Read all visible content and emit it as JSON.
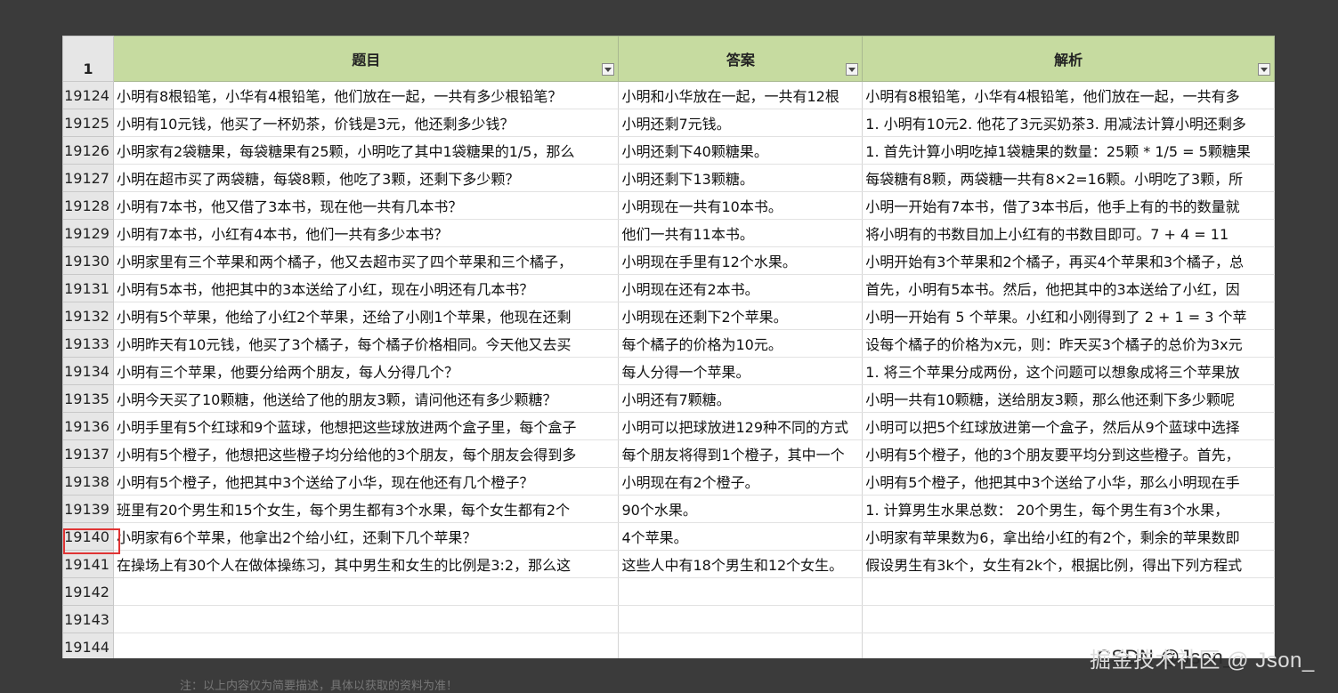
{
  "sheet": {
    "corner_label": "1",
    "columns": [
      "题目",
      "答案",
      "解析"
    ],
    "rows": [
      {
        "num": "19124",
        "q": "小明有8根铅笔，小华有4根铅笔，他们放在一起，一共有多少根铅笔？",
        "a": "小明和小华放在一起，一共有12根",
        "e": "小明有8根铅笔，小华有4根铅笔，他们放在一起，一共有多"
      },
      {
        "num": "19125",
        "q": "小明有10元钱，他买了一杯奶茶，价钱是3元，他还剩多少钱？",
        "a": "小明还剩7元钱。",
        "e": "1. 小明有10元2. 他花了3元买奶茶3. 用减法计算小明还剩多"
      },
      {
        "num": "19126",
        "q": "小明家有2袋糖果，每袋糖果有25颗，小明吃了其中1袋糖果的1/5，那么",
        "a": "小明还剩下40颗糖果。",
        "e": "1. 首先计算小明吃掉1袋糖果的数量：25颗 * 1/5 = 5颗糖果"
      },
      {
        "num": "19127",
        "q": "小明在超市买了两袋糖，每袋8颗，他吃了3颗，还剩下多少颗？",
        "a": "小明还剩下13颗糖。",
        "e": "每袋糖有8颗，两袋糖一共有8×2=16颗。小明吃了3颗，所"
      },
      {
        "num": "19128",
        "q": "小明有7本书，他又借了3本书，现在他一共有几本书？",
        "a": "小明现在一共有10本书。",
        "e": "小明一开始有7本书，借了3本书后，他手上有的书的数量就"
      },
      {
        "num": "19129",
        "q": "小明有7本书，小红有4本书，他们一共有多少本书？",
        "a": "他们一共有11本书。",
        "e": "将小明有的书数目加上小红有的书数目即可。7 + 4 = 11"
      },
      {
        "num": "19130",
        "q": "小明家里有三个苹果和两个橘子，他又去超市买了四个苹果和三个橘子，",
        "a": "小明现在手里有12个水果。",
        "e": "小明开始有3个苹果和2个橘子，再买4个苹果和3个橘子，总"
      },
      {
        "num": "19131",
        "q": "小明有5本书，他把其中的3本送给了小红，现在小明还有几本书？",
        "a": "小明现在还有2本书。",
        "e": "首先，小明有5本书。然后，他把其中的3本送给了小红，因"
      },
      {
        "num": "19132",
        "q": "小明有5个苹果，他给了小红2个苹果，还给了小刚1个苹果，他现在还剩",
        "a": "小明现在还剩下2个苹果。",
        "e": "小明一开始有 5 个苹果。小红和小刚得到了 2 + 1 = 3 个苹"
      },
      {
        "num": "19133",
        "q": "小明昨天有10元钱，他买了3个橘子，每个橘子价格相同。今天他又去买",
        "a": "每个橘子的价格为10元。",
        "e": "设每个橘子的价格为x元，则：昨天买3个橘子的总价为3x元"
      },
      {
        "num": "19134",
        "q": "小明有三个苹果，他要分给两个朋友，每人分得几个？",
        "a": "每人分得一个苹果。",
        "e": "1. 将三个苹果分成两份，这个问题可以想象成将三个苹果放"
      },
      {
        "num": "19135",
        "q": "小明今天买了10颗糖，他送给了他的朋友3颗，请问他还有多少颗糖？",
        "a": "小明还有7颗糖。",
        "e": "小明一共有10颗糖，送给朋友3颗，那么他还剩下多少颗呢"
      },
      {
        "num": "19136",
        "q": "小明手里有5个红球和9个蓝球，他想把这些球放进两个盒子里，每个盒子",
        "a": "小明可以把球放进129种不同的方式",
        "e": "小明可以把5个红球放进第一个盒子，然后从9个蓝球中选择"
      },
      {
        "num": "19137",
        "q": "小明有5个橙子，他想把这些橙子均分给他的3个朋友，每个朋友会得到多",
        "a": "每个朋友将得到1个橙子，其中一个",
        "e": "小明有5个橙子，他的3个朋友要平均分到这些橙子。首先，"
      },
      {
        "num": "19138",
        "q": "小明有5个橙子，他把其中3个送给了小华，现在他还有几个橙子？",
        "a": "小明现在有2个橙子。",
        "e": "小明有5个橙子，他把其中3个送给了小华，那么小明现在手"
      },
      {
        "num": "19139",
        "q": "班里有20个男生和15个女生，每个男生都有3个水果，每个女生都有2个",
        "a": "90个水果。",
        "e": "1. 计算男生水果总数：    20个男生，每个男生有3个水果，"
      },
      {
        "num": "19140",
        "q": "小明家有6个苹果，他拿出2个给小红，还剩下几个苹果？",
        "a": "4个苹果。",
        "e": "小明家有苹果数为6，拿出给小红的有2个，剩余的苹果数即"
      },
      {
        "num": "19141",
        "q": "在操场上有30个人在做体操练习，其中男生和女生的比例是3:2，那么这",
        "a": "这些人中有18个男生和12个女生。",
        "e": "假设男生有3k个，女生有2k个，根据比例，得出下列方程式"
      },
      {
        "num": "19142",
        "q": "",
        "a": "",
        "e": ""
      },
      {
        "num": "19143",
        "q": "",
        "a": "",
        "e": ""
      },
      {
        "num": "19144",
        "q": "",
        "a": "",
        "e": ""
      }
    ]
  },
  "highlight_row": "19140",
  "watermark": "掘金技术社区 @ Json_",
  "watermark_shadow": "CSDN @Json_",
  "footnote": "注：以上内容仅为简要描述，具体以获取的资料为准！",
  "colors": {
    "header_bg": "#c6dba0",
    "highlight_border": "#e03434",
    "backdrop": "#3b3b3b"
  }
}
